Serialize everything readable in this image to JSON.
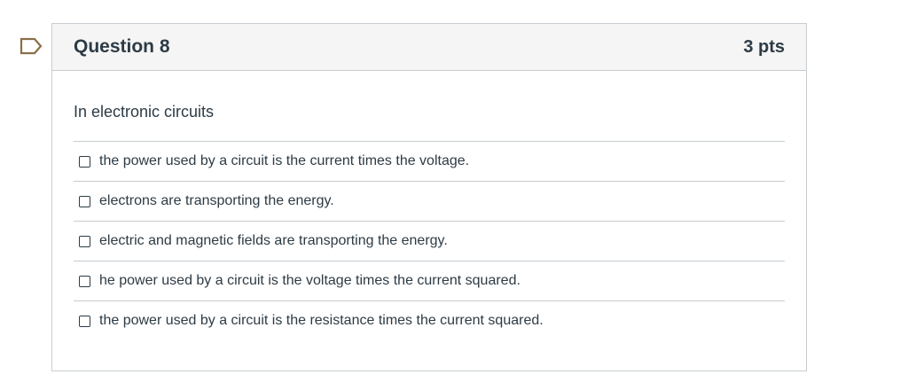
{
  "question": {
    "title": "Question 8",
    "points": "3 pts",
    "text": "In electronic circuits",
    "flag_icon": "bookmark-flag-icon",
    "answers": [
      {
        "label": "the power used by a circuit is the current times the voltage.",
        "checked": false
      },
      {
        "label": "electrons are transporting the energy.",
        "checked": false
      },
      {
        "label": "electric and magnetic fields are transporting the energy.",
        "checked": false
      },
      {
        "label": "he power used by a circuit is the voltage times the current squared.",
        "checked": false
      },
      {
        "label": "the power used by a circuit is the resistance times the current squared.",
        "checked": false
      }
    ]
  },
  "colors": {
    "text": "#2d3b45",
    "border": "#c7cdd1",
    "header_bg": "#f5f5f5",
    "flag": "#8b6f47"
  }
}
